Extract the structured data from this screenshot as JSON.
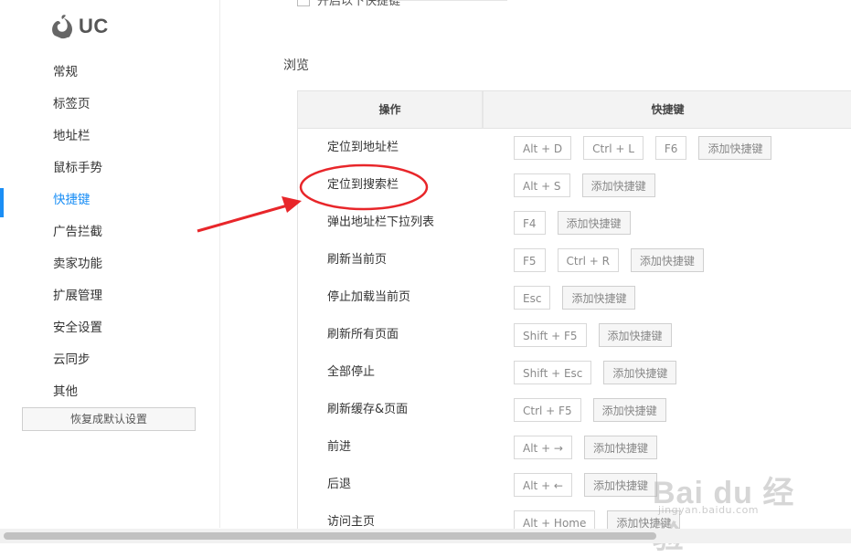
{
  "app": {
    "logo_text": "UC"
  },
  "sidebar": {
    "items": [
      {
        "label": "常规"
      },
      {
        "label": "标签页"
      },
      {
        "label": "地址栏"
      },
      {
        "label": "鼠标手势"
      },
      {
        "label": "快捷键",
        "active": true
      },
      {
        "label": "广告拦截"
      },
      {
        "label": "卖家功能"
      },
      {
        "label": "扩展管理"
      },
      {
        "label": "安全设置"
      },
      {
        "label": "云同步"
      },
      {
        "label": "其他"
      }
    ],
    "restore_label": "恢复成默认设置"
  },
  "top_checkbox": {
    "label": "开启以下快捷键"
  },
  "section": {
    "title": "浏览"
  },
  "table": {
    "headers": {
      "operation": "操作",
      "shortcut": "快捷键"
    },
    "add_label": "添加快捷键",
    "rows": [
      {
        "name": "定位到地址栏",
        "keys": [
          "Alt + D",
          "Ctrl + L",
          "F6"
        ]
      },
      {
        "name": "定位到搜索栏",
        "keys": [
          "Alt + S"
        ]
      },
      {
        "name": "弹出地址栏下拉列表",
        "keys": [
          "F4"
        ]
      },
      {
        "name": "刷新当前页",
        "keys": [
          "F5",
          "Ctrl + R"
        ]
      },
      {
        "name": "停止加载当前页",
        "keys": [
          "Esc"
        ]
      },
      {
        "name": "刷新所有页面",
        "keys": [
          "Shift + F5"
        ]
      },
      {
        "name": "全部停止",
        "keys": [
          "Shift + Esc"
        ]
      },
      {
        "name": "刷新缓存&页面",
        "keys": [
          "Ctrl + F5"
        ]
      },
      {
        "name": "前进",
        "keys": [
          "Alt + →"
        ]
      },
      {
        "name": "后退",
        "keys": [
          "Alt + ←"
        ]
      },
      {
        "name": "访问主页",
        "keys": [
          "Alt + Home"
        ]
      }
    ]
  },
  "annotation": {
    "color": "#e8262a"
  },
  "watermark": {
    "text": "Bai du 经验",
    "sub": "jingyan.baidu.com"
  },
  "colors": {
    "accent": "#1a8ef5"
  }
}
